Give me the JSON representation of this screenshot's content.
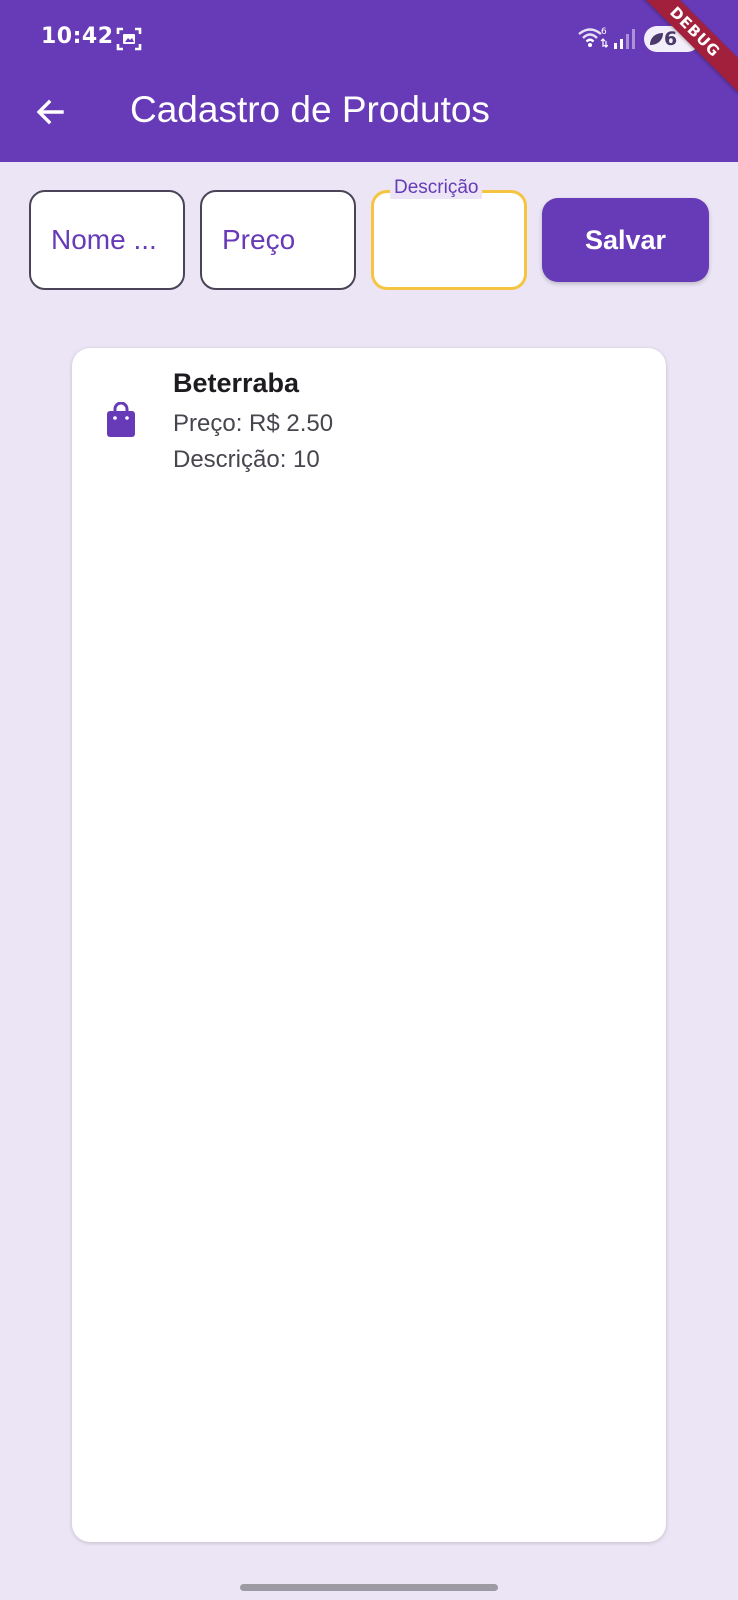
{
  "status_bar": {
    "time": "10:42",
    "battery": "6",
    "debug_label": "DEBUG"
  },
  "app_bar": {
    "title": "Cadastro de Produtos",
    "back_icon": "arrow-back-icon"
  },
  "form": {
    "name_field": {
      "value": "Nome ..."
    },
    "price_field": {
      "value": "Preço"
    },
    "description_field": {
      "label": "Descrição",
      "value": ""
    },
    "save_label": "Salvar"
  },
  "products": [
    {
      "icon": "shopping-bag-icon",
      "name": "Beterraba",
      "price": "Preço: R$ 2.50",
      "description": "Descrição: 10"
    }
  ],
  "colors": {
    "primary": "#673ab7",
    "background": "#ebe5f5",
    "focus": "#f5c542",
    "debug": "#a3203d"
  }
}
